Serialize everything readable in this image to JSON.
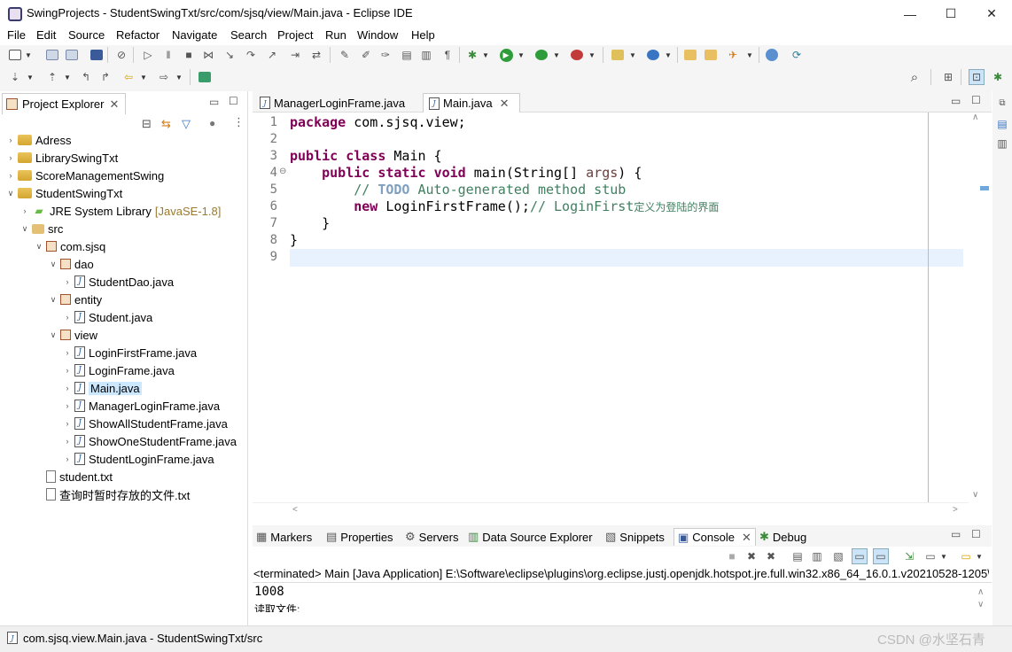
{
  "window": {
    "title": "SwingProjects - StudentSwingTxt/src/com/sjsq/view/Main.java - Eclipse IDE",
    "minimize": "—",
    "maximize": "☐",
    "close": "✕"
  },
  "menu": [
    "File",
    "Edit",
    "Source",
    "Refactor",
    "Navigate",
    "Search",
    "Project",
    "Run",
    "Window",
    "Help"
  ],
  "explorer": {
    "tab_label": "Project Explorer",
    "tree": [
      {
        "label": "Adress",
        "type": "project",
        "depth": 0,
        "expanded": false
      },
      {
        "label": "LibrarySwingTxt",
        "type": "project",
        "depth": 0,
        "expanded": false
      },
      {
        "label": "ScoreManagementSwing",
        "type": "project",
        "depth": 0,
        "expanded": false
      },
      {
        "label": "StudentSwingTxt",
        "type": "project",
        "depth": 0,
        "expanded": true
      },
      {
        "label": "JRE System Library",
        "suffix": "[JavaSE-1.8]",
        "type": "lib",
        "depth": 1,
        "expanded": false
      },
      {
        "label": "src",
        "type": "src",
        "depth": 1,
        "expanded": true
      },
      {
        "label": "com.sjsq",
        "type": "pkg",
        "depth": 2,
        "expanded": true
      },
      {
        "label": "dao",
        "type": "pkg",
        "depth": 3,
        "expanded": true
      },
      {
        "label": "StudentDao.java",
        "type": "java",
        "depth": 4,
        "expanded": false
      },
      {
        "label": "entity",
        "type": "pkg",
        "depth": 3,
        "expanded": true
      },
      {
        "label": "Student.java",
        "type": "java",
        "depth": 4,
        "expanded": false
      },
      {
        "label": "view",
        "type": "pkg",
        "depth": 3,
        "expanded": true
      },
      {
        "label": "LoginFirstFrame.java",
        "type": "java",
        "depth": 4,
        "expanded": false
      },
      {
        "label": "LoginFrame.java",
        "type": "java",
        "depth": 4,
        "expanded": false
      },
      {
        "label": "Main.java",
        "type": "java",
        "depth": 4,
        "expanded": false,
        "selected": true
      },
      {
        "label": "ManagerLoginFrame.java",
        "type": "java",
        "depth": 4,
        "expanded": false
      },
      {
        "label": "ShowAllStudentFrame.java",
        "type": "java",
        "depth": 4,
        "expanded": false
      },
      {
        "label": "ShowOneStudentFrame.java",
        "type": "java",
        "depth": 4,
        "expanded": false
      },
      {
        "label": "StudentLoginFrame.java",
        "type": "java",
        "depth": 4,
        "expanded": false
      },
      {
        "label": "student.txt",
        "type": "txt",
        "depth": 2,
        "expanded": null
      },
      {
        "label": "查询时暂时存放的文件.txt",
        "type": "txt",
        "depth": 2,
        "expanded": null
      }
    ]
  },
  "editor": {
    "tabs": [
      {
        "label": "ManagerLoginFrame.java",
        "active": false
      },
      {
        "label": "Main.java",
        "active": true
      }
    ],
    "lines": [
      {
        "n": "1",
        "html": "<span class=\"kw\">package</span> com.sjsq.view;"
      },
      {
        "n": "2",
        "html": ""
      },
      {
        "n": "3",
        "html": "<span class=\"kw\">public</span> <span class=\"kw\">class</span> Main {"
      },
      {
        "n": "4",
        "html": "    <span class=\"kw\">public</span> <span class=\"kw\">static</span> <span class=\"kw\">void</span> main(String[] <span style=\"color:#6a3e3e\">args</span>) {"
      },
      {
        "n": "5",
        "html": "        <span class=\"cm\">// </span><span class=\"todo\">TODO</span><span class=\"cm\"> Auto-generated method stub</span>"
      },
      {
        "n": "6",
        "html": "        <span class=\"kw\">new</span> LoginFirstFrame();<span class=\"cm\">// LoginFirst<span style=\"font-family:'DejaVu Sans',sans-serif;font-size:12px\">定义为登陆的界面</span></span>"
      },
      {
        "n": "7",
        "html": "    }"
      },
      {
        "n": "8",
        "html": "}"
      },
      {
        "n": "9",
        "html": ""
      }
    ]
  },
  "console": {
    "tabs": [
      "Markers",
      "Properties",
      "Servers",
      "Data Source Explorer",
      "Snippets",
      "Console",
      "Debug"
    ],
    "header": "<terminated> Main [Java Application] E:\\Software\\eclipse\\plugins\\org.eclipse.justj.openjdk.hotspot.jre.full.win32.x86_64_16.0.1.v20210528-1205\\",
    "output_line1": "1008",
    "output_line2": "读取文件:"
  },
  "status": {
    "text": "com.sjsq.view.Main.java - StudentSwingTxt/src",
    "watermark": "CSDN @水坚石青"
  }
}
